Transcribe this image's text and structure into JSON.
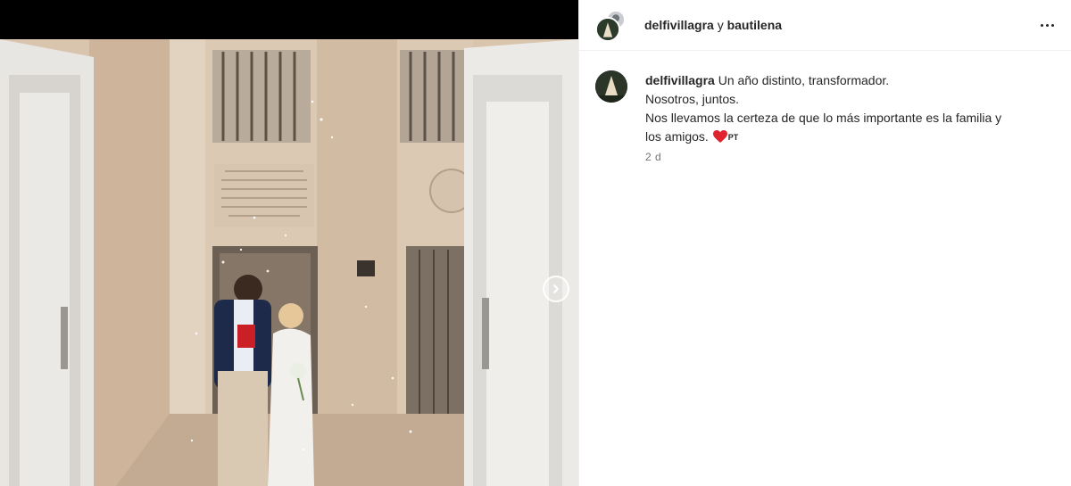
{
  "post": {
    "author": "delfivillagra",
    "connector": "y",
    "collaborator": "bautilena",
    "more_icon": "more-horizontal-icon",
    "next_icon": "chevron-right-icon"
  },
  "caption": {
    "username": "delfivillagra",
    "line1": "Un año distinto, transformador.",
    "line2": "Nosotros, juntos.",
    "line3": "Nos llevamos la certeza de que lo más importante es la familia y",
    "line4": "los amigos.",
    "emoji_heart": "heart-icon",
    "flag_text": "PT",
    "timestamp": "2 d"
  },
  "colors": {
    "text": "#262626",
    "muted": "#737373",
    "heart": "#e0242f",
    "divider": "#efefef"
  }
}
